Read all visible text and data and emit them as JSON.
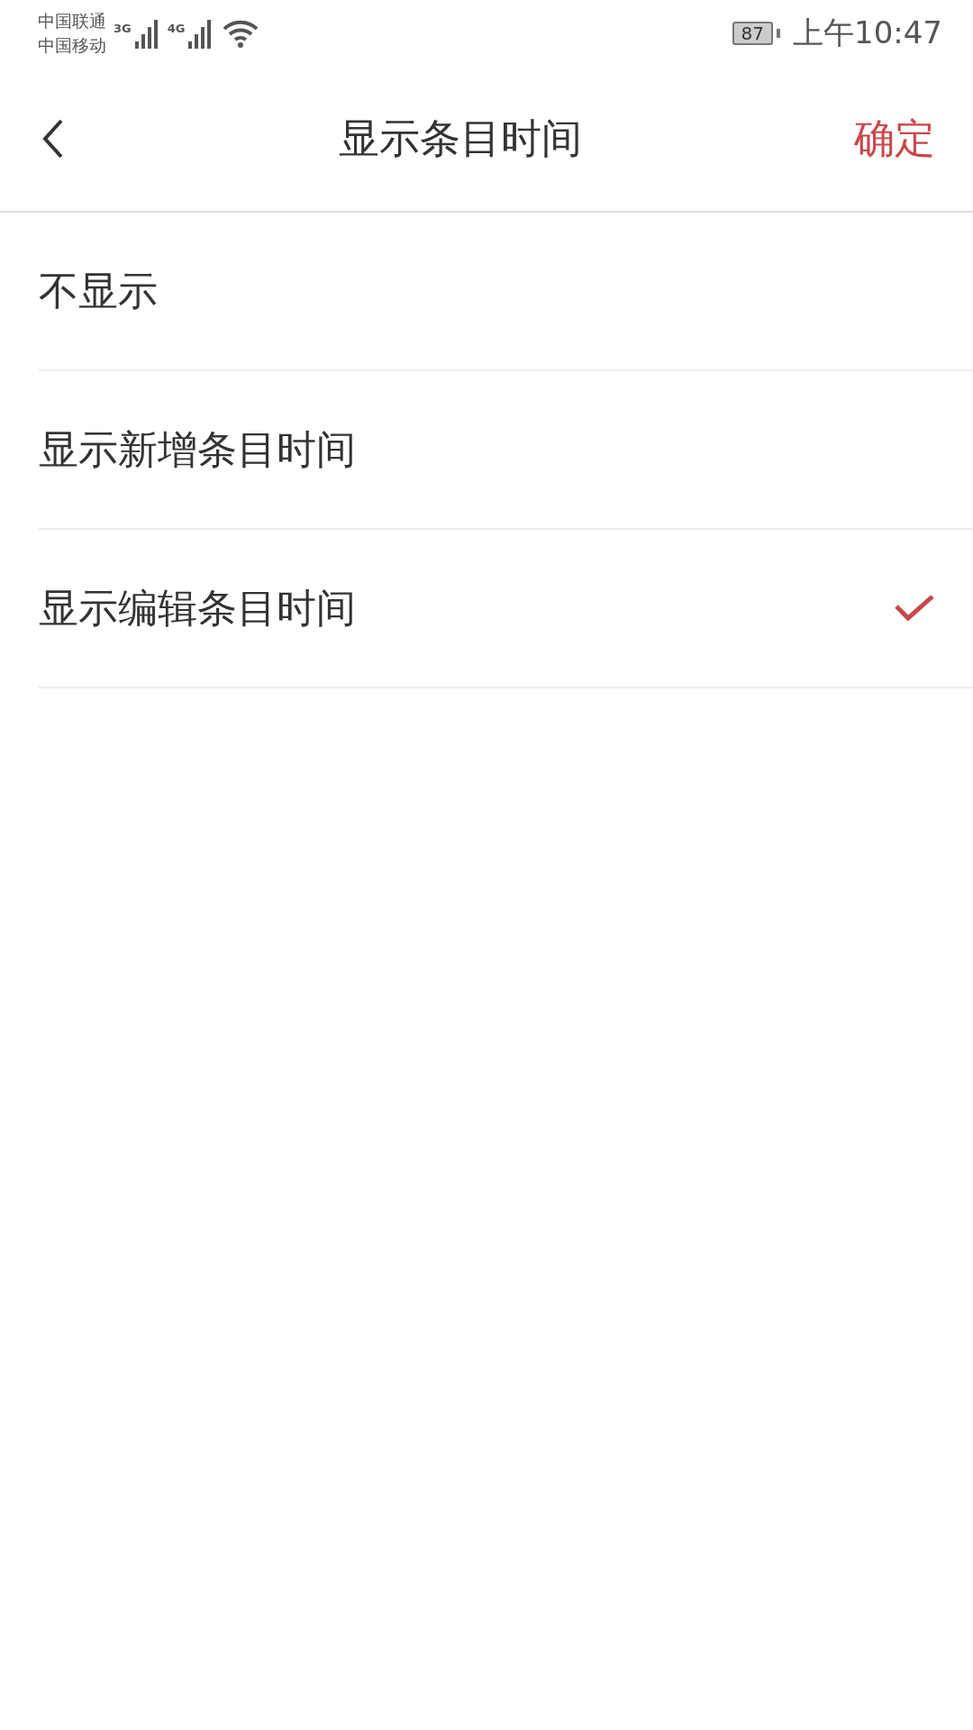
{
  "status_bar": {
    "carriers": [
      "中国联通",
      "中国移动"
    ],
    "networks": [
      "3G",
      "4G"
    ],
    "battery": "87",
    "time": "上午10:47"
  },
  "header": {
    "title": "显示条目时间",
    "confirm": "确定"
  },
  "options": [
    {
      "label": "不显示",
      "selected": false
    },
    {
      "label": "显示新增条目时间",
      "selected": false
    },
    {
      "label": "显示编辑条目时间",
      "selected": true
    }
  ]
}
